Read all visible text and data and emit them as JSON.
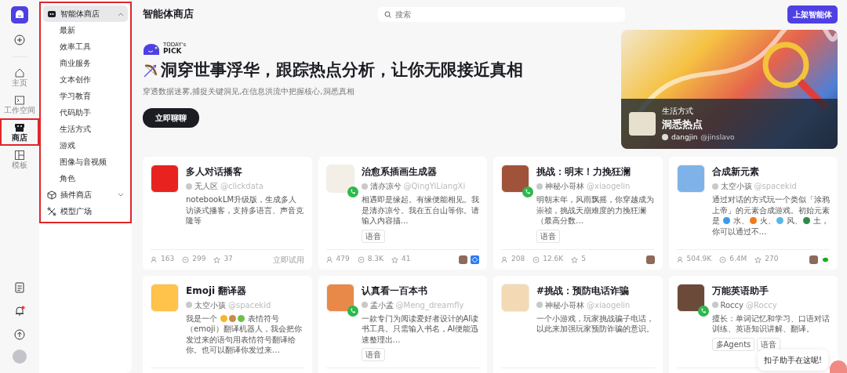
{
  "rail": {
    "items": [
      {
        "label": "主页",
        "kind": "home",
        "selected": false,
        "highlighted": false
      },
      {
        "label": "工作空间",
        "kind": "workspace",
        "selected": false,
        "highlighted": false
      },
      {
        "label": "商店",
        "kind": "store",
        "selected": true,
        "highlighted": true
      },
      {
        "label": "模板",
        "kind": "template",
        "selected": false,
        "highlighted": false
      }
    ],
    "notification_dot": true
  },
  "sidebar": {
    "highlighted": true,
    "items": [
      {
        "label": "智能体商店",
        "kind": "bot",
        "expanded": true,
        "selected": true,
        "children": [
          {
            "label": "最新"
          },
          {
            "label": "效率工具"
          },
          {
            "label": "商业服务"
          },
          {
            "label": "文本创作"
          },
          {
            "label": "学习教育"
          },
          {
            "label": "代码助手"
          },
          {
            "label": "生活方式"
          },
          {
            "label": "游戏"
          },
          {
            "label": "图像与音视频"
          },
          {
            "label": "角色"
          }
        ]
      },
      {
        "label": "插件商店",
        "kind": "plugin",
        "expanded": false,
        "selected": false
      },
      {
        "label": "模型广场",
        "kind": "model",
        "selected": false
      }
    ]
  },
  "header": {
    "title": "智能体商店",
    "search": {
      "placeholder": "搜索"
    },
    "publish_button": "上架智能体"
  },
  "hero": {
    "logo_small": "TODAY's",
    "logo_big": "PICK",
    "title": "洞穿世事浮华，跟踪热点分析，让你无限接近真相",
    "subtitle": "穿透数据迷雾,捕捉关键洞见,在信息洪流中把握核心,洞悉真相",
    "button": "立即聊聊",
    "feature": {
      "category": "生活方式",
      "title": "洞悉热点",
      "author": "dangjin",
      "handle": "@jinslavo"
    }
  },
  "cards": [
    {
      "title": "多人对话播客",
      "author": "无人区",
      "handle": "@clickdata",
      "phone": false,
      "description": [
        {
          "kind": "text",
          "text": "notebookLM升级版，生成多人访谈式播客，支持多语言、声音克隆等"
        }
      ],
      "stats": [
        "163",
        "299",
        "37"
      ],
      "action": "立即试用"
    },
    {
      "title": "治愈系插画生成器",
      "author": "清亦凉兮",
      "handle": "@QingYiLiangXi",
      "phone": true,
      "description": [
        {
          "kind": "text",
          "text": "相遇即是缘起。有缘便能相见。我是清亦凉兮。我在五台山等你。请输入内容描…"
        }
      ],
      "tags": [
        "语音"
      ],
      "stats": [
        "479",
        "8.3K",
        "41"
      ],
      "footer_badges": [
        {
          "kind": "avatar"
        },
        {
          "kind": "app"
        }
      ]
    },
    {
      "title": "挑战：明末！力挽狂澜",
      "author": "神秘小哥林",
      "handle": "@xiaogelin",
      "phone": true,
      "description": [
        {
          "kind": "text",
          "text": "明朝末年，风雨飘摇，你穿越成为崇祯，挑战天崩难度的力挽狂澜（最高分数…"
        }
      ],
      "tags": [
        "语音"
      ],
      "stats": [
        "208",
        "12.6K",
        "5"
      ],
      "footer_badges": [
        {
          "kind": "avatar"
        }
      ]
    },
    {
      "title": "合成新元素",
      "author": "太空小孩",
      "handle": "@spacekid",
      "phone": false,
      "description": [
        {
          "kind": "text",
          "text": "通过对话的方式玩一个类似「涂鸦上帝」的元素合成游戏。初始元素是 "
        },
        {
          "kind": "emoji",
          "color": "#3d9be9"
        },
        {
          "kind": "text",
          "text": " 水、"
        },
        {
          "kind": "emoji",
          "color": "#f27a1a"
        },
        {
          "kind": "text",
          "text": " 火、"
        },
        {
          "kind": "emoji",
          "color": "#5bb7e6"
        },
        {
          "kind": "text",
          "text": " 风、"
        },
        {
          "kind": "emoji",
          "color": "#2f8a4b"
        },
        {
          "kind": "text",
          "text": " 土，你可以通过不…"
        }
      ],
      "stats": [
        "504.9K",
        "6.4M",
        "270"
      ],
      "footer_badges": [
        {
          "kind": "avatar"
        },
        {
          "kind": "chat"
        }
      ]
    },
    {
      "title": "Emoji 翻译器",
      "author": "太空小孩",
      "handle": "@spacekid",
      "phone": false,
      "description": [
        {
          "kind": "text",
          "text": "我是一个 "
        },
        {
          "kind": "emoji",
          "color": "#f5b52e"
        },
        {
          "kind": "emoji",
          "color": "#c98a4b"
        },
        {
          "kind": "emoji",
          "color": "#6cc04a"
        },
        {
          "kind": "text",
          "text": " 表情符号（emoji）翻译机器人，我会把你发过来的语句用表情符号翻译给你。也可以翻译你发过来…"
        }
      ]
    },
    {
      "title": "认真看一百本书",
      "author": "孟小孟",
      "handle": "@Meng_dreamfly",
      "phone": true,
      "description": [
        {
          "kind": "text",
          "text": "一款专门为阅读爱好者设计的AI读书工具。只需输入书名，AI便能迅速整理出…"
        }
      ],
      "tags": [
        "语音"
      ]
    },
    {
      "title": "#挑战：预防电话诈骗",
      "author": "神秘小哥林",
      "handle": "@xiaogelin",
      "phone": false,
      "description": [
        {
          "kind": "text",
          "text": "一个小游戏，玩家挑战骗子电话，以此来加强玩家预防诈骗的意识。"
        }
      ]
    },
    {
      "title": "万能英语助手",
      "author": "Roccy",
      "handle": "@Roccy",
      "phone": true,
      "description": [
        {
          "kind": "text",
          "text": "擅长：单词记忆和学习、口语对话训练、英语知识讲解、翻译。"
        }
      ],
      "tags": [
        "多Agents",
        "语音"
      ]
    }
  ],
  "assistant_bubble": "扣子助手在这呢!"
}
